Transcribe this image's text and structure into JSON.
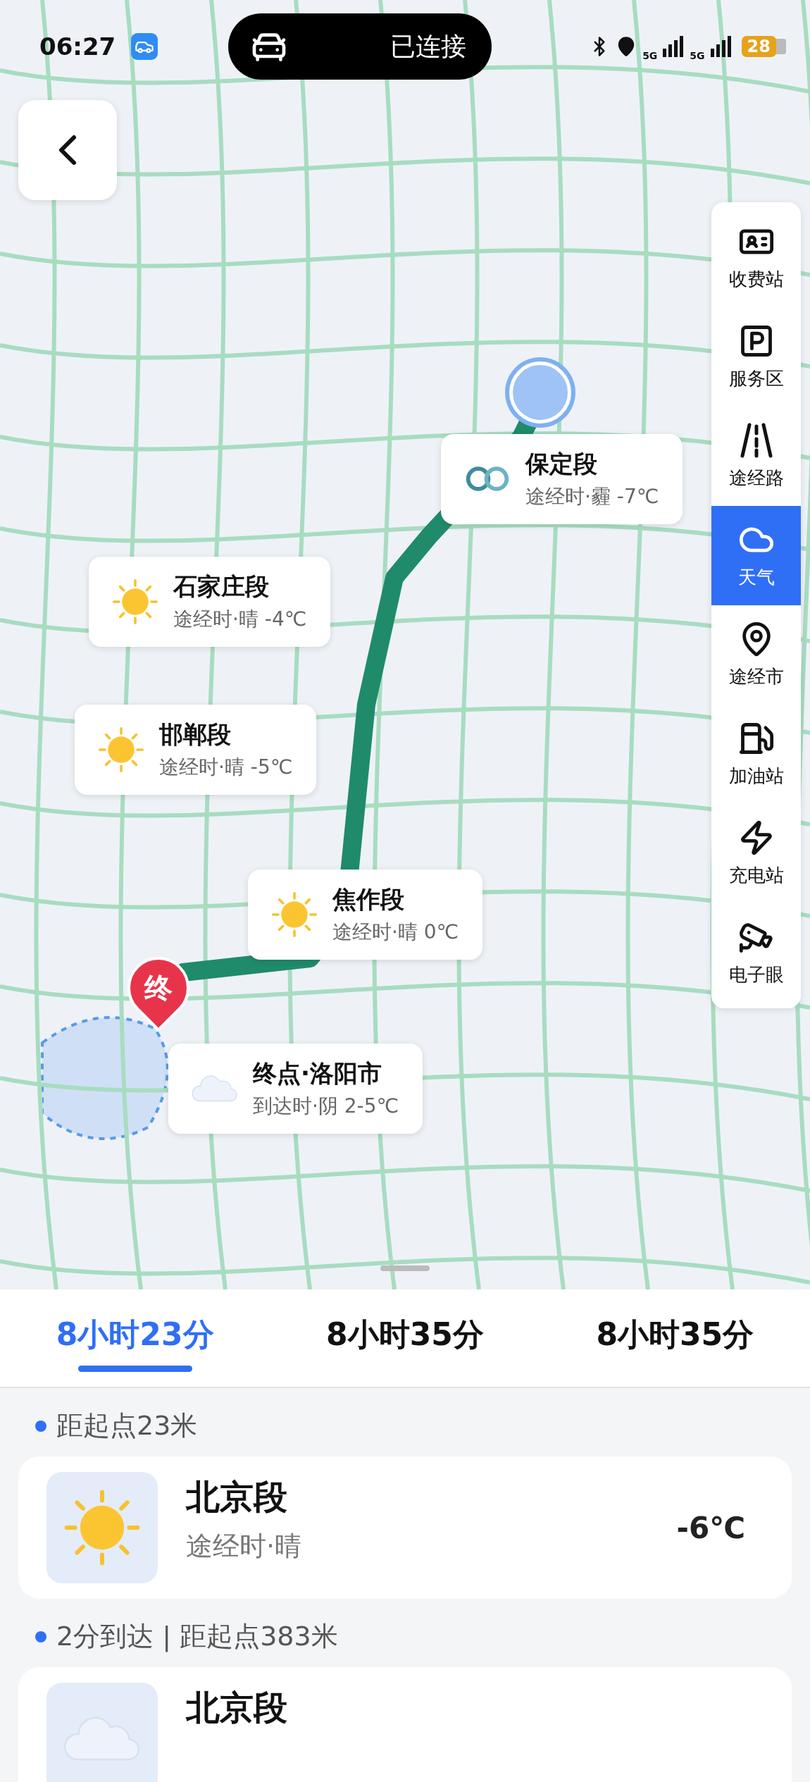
{
  "status_bar": {
    "time": "06:27",
    "connection": "已连接",
    "network_labels": [
      "5G",
      "5G"
    ],
    "battery": "28"
  },
  "map": {
    "end_marker": "终",
    "callouts": [
      {
        "kind": "haze",
        "title": "保定段",
        "subtitle": "途经时·霾 -7℃"
      },
      {
        "kind": "sunny",
        "title": "石家庄段",
        "subtitle": "途经时·晴 -4℃"
      },
      {
        "kind": "sunny",
        "title": "邯郸段",
        "subtitle": "途经时·晴 -5℃"
      },
      {
        "kind": "sunny",
        "title": "焦作段",
        "subtitle": "途经时·晴 0℃"
      },
      {
        "kind": "cloudy",
        "title": "终点·洛阳市",
        "subtitle": "到达时·阴 2-5℃"
      }
    ]
  },
  "sidebar": {
    "items": [
      {
        "label": "收费站",
        "selected": false
      },
      {
        "label": "服务区",
        "selected": false
      },
      {
        "label": "途经路",
        "selected": false
      },
      {
        "label": "天气",
        "selected": true
      },
      {
        "label": "途经市",
        "selected": false
      },
      {
        "label": "加油站",
        "selected": false
      },
      {
        "label": "充电站",
        "selected": false
      },
      {
        "label": "电子眼",
        "selected": false
      }
    ]
  },
  "route_tabs": [
    {
      "label": "8小时23分",
      "selected": true
    },
    {
      "label": "8小时35分",
      "selected": false
    },
    {
      "label": "8小时35分",
      "selected": false
    }
  ],
  "sections": [
    {
      "header": "距起点23米",
      "card": {
        "kind": "sunny",
        "title": "北京段",
        "subtitle": "途经时·晴",
        "temperature": "-6℃"
      }
    },
    {
      "header": "2分到达 | 距起点383米",
      "card": {
        "kind": "cloudy",
        "title": "北京段"
      }
    }
  ]
}
